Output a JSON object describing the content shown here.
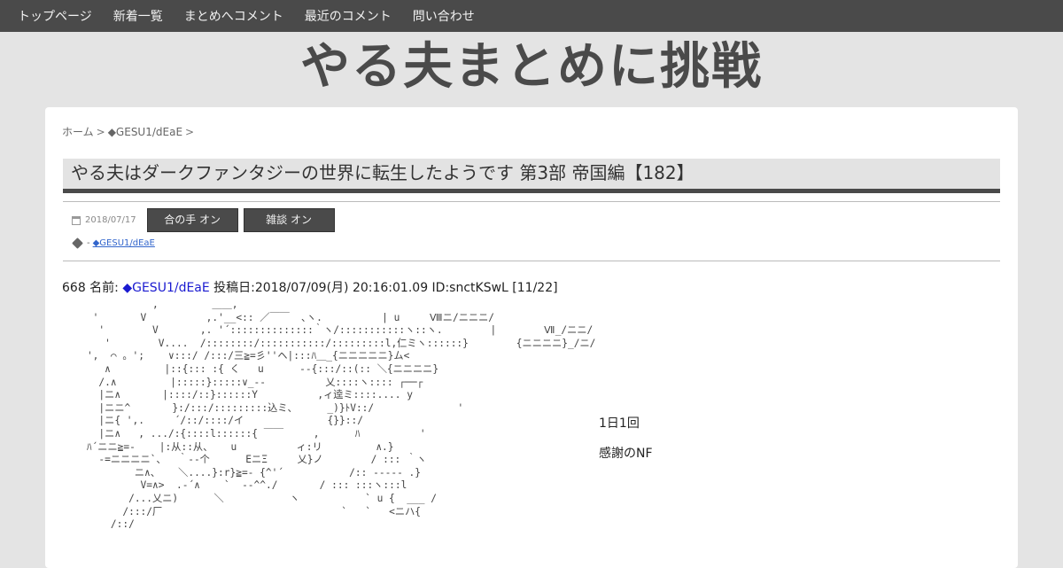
{
  "nav": {
    "items": [
      {
        "label": "トップページ"
      },
      {
        "label": "新着一覧"
      },
      {
        "label": "まとめへコメント"
      },
      {
        "label": "最近のコメント"
      },
      {
        "label": "問い合わせ"
      }
    ]
  },
  "site": {
    "title": "やる夫まとめに挑戦"
  },
  "breadcrumb": {
    "home": "ホーム",
    "sep": ">",
    "author": "◆GESU1/dEaE"
  },
  "post": {
    "title": "やる夫はダークファンタジーの世界に転生したようです 第3部 帝国編【182】",
    "date": "2018/07/17",
    "toggle_aite": "合の手 オン",
    "toggle_zatsudan": "雑談 オン",
    "tag_dash": "-",
    "tag": "◆GESU1/dEaE"
  },
  "res": {
    "number_label": "668 名前: ",
    "name": "◆GESU1/dEaE",
    "rest": " 投稿日:2018/07/09(月) 20:16:01.09 ID:snctKSwL [11/22]",
    "aa": "               ,         ＿＿,\n     '       V          ,.'__<:: ／￣￣  ､ヽ.          | u     Ⅷニ/ニニニ/\n      '        V       ,. '´::::::::::::::｀ヽ/:::::::::::ヽ::ヽ.        |        Ⅶ_/ニニ/\n       '        V....  /::::::::/:::::::::::/:::::::::l,仁ミヽ::::::}        {ニニニニ}_/ニ/\n    ',  ⌒ 。';    ∨:::/ /:::/三≧=彡''ヘ|:::ﾊ＿_{ニニニニニ}ム<\n       ∧         |::{::: :{ く   u      --{:::/::(:: ＼{ニニニニ}\n      /.∧         |:::::}:::::∨_--          乂::::ヽ:::: ┌──┌\n      |ニ∧       |::::/::}::::::Y          ,ィ逵ミ::::.... y\n      |ニニ^       }:/:::/:::::::::込ミ、     _)}ﾄV::/              '\n      |ニ{ ',.     ´/::/::::/イ              {}}::/\n      |ニ∧   , .../:{::::l::::::{ ￣￣     ,      ﾊ          '\n    ﾊ´ニニ≧=-    |:从::从、   u          ィ:リ         ∧.}\n      -=ニニニニ`、  ｀--个      ΕニΞ     乂}ノ        / ::: ｀ヽ\n            ニ∧、   ＼....}:r}≧=- {^'´           /:: ----- .}\n             V=∧>  .-´∧    `  --^^./       / ::: :::ヽ:::l\n           /...乂ニ)      ＼           ヽ           ` u {  ___ /\n          /:::/厂                              `   `   <ニハ{\n        /::/",
    "line1": "1日1回",
    "line2": "感謝のNF"
  }
}
